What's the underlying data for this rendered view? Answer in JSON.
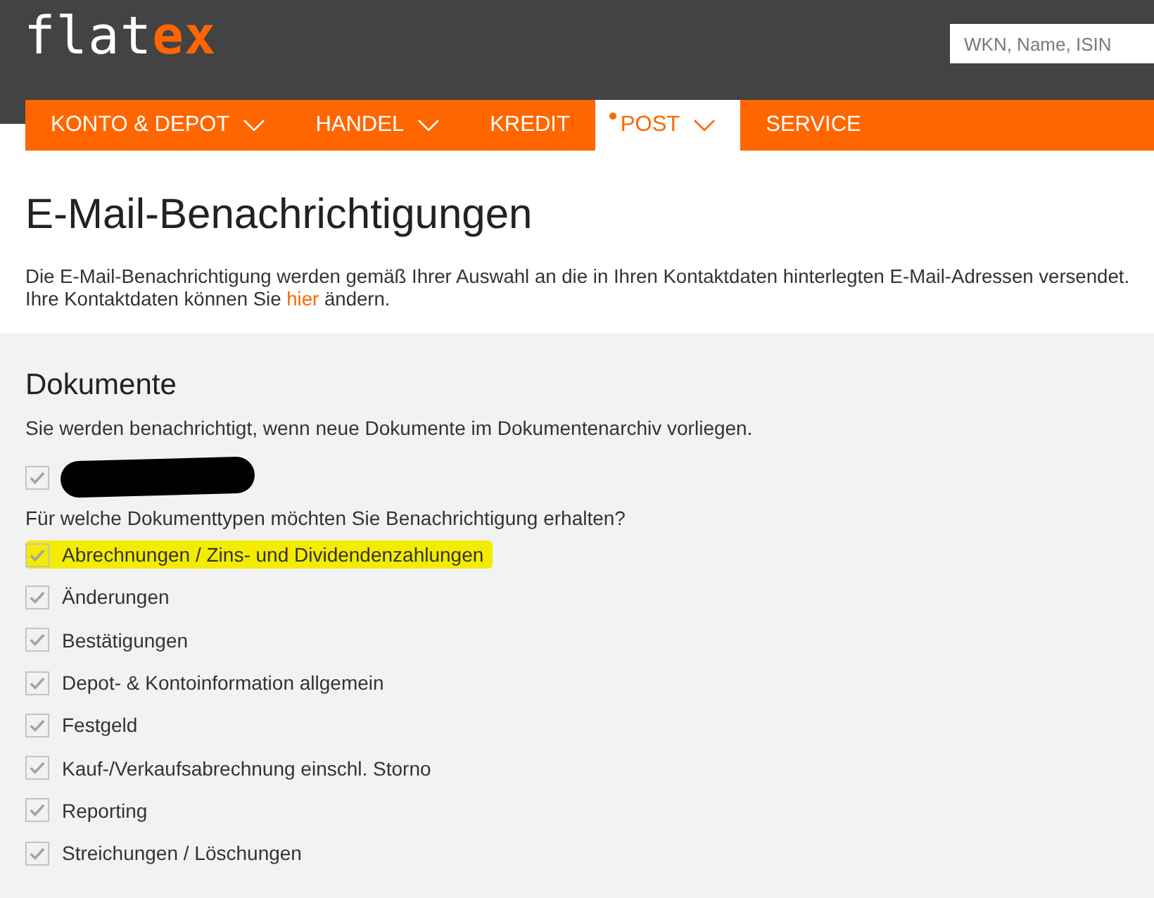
{
  "header": {
    "logo": {
      "text": "flat",
      "accent": "ex"
    },
    "search": {
      "placeholder": "WKN, Name, ISIN"
    }
  },
  "nav": [
    {
      "label": "KONTO & DEPOT",
      "has_menu": true,
      "selected": false,
      "notification_dot": false
    },
    {
      "label": "HANDEL",
      "has_menu": true,
      "selected": false,
      "notification_dot": false
    },
    {
      "label": "KREDIT",
      "has_menu": false,
      "selected": false,
      "notification_dot": false
    },
    {
      "label": "POST",
      "has_menu": true,
      "selected": true,
      "notification_dot": true
    },
    {
      "label": "SERVICE",
      "has_menu": false,
      "selected": false,
      "notification_dot": false
    }
  ],
  "page": {
    "title": "E-Mail-Benachrichtigungen",
    "intro": {
      "sentence": "Die E-Mail-Benachrichtigung werden gemäß Ihrer Auswahl an die in Ihren Kontaktdaten hinterlegten E-Mail-Adressen versendet.",
      "before_link": "Ihre Kontaktdaten können Sie ",
      "link": "hier",
      "after_link": " ändern."
    }
  },
  "documents": {
    "heading": "Dokumente",
    "description": "Sie werden benachrichtigt, wenn neue Dokumente im Dokumentenarchiv vorliegen.",
    "address_option": {
      "checked": true,
      "redacted": true
    },
    "question": "Für welche Dokumenttypen möchten Sie Benachrichtigung erhalten?",
    "types": [
      {
        "label": "Abrechnungen / Zins- und Dividendenzahlungen",
        "checked": true,
        "highlighted": true
      },
      {
        "label": "Änderungen",
        "checked": true,
        "highlighted": false
      },
      {
        "label": "Bestätigungen",
        "checked": true,
        "highlighted": false
      },
      {
        "label": "Depot- & Kontoinformation allgemein",
        "checked": true,
        "highlighted": false
      },
      {
        "label": "Festgeld",
        "checked": true,
        "highlighted": false
      },
      {
        "label": "Kauf-/Verkaufsabrechnung einschl. Storno",
        "checked": true,
        "highlighted": false
      },
      {
        "label": "Reporting",
        "checked": true,
        "highlighted": false
      },
      {
        "label": "Streichungen / Löschungen",
        "checked": true,
        "highlighted": false
      }
    ]
  }
}
